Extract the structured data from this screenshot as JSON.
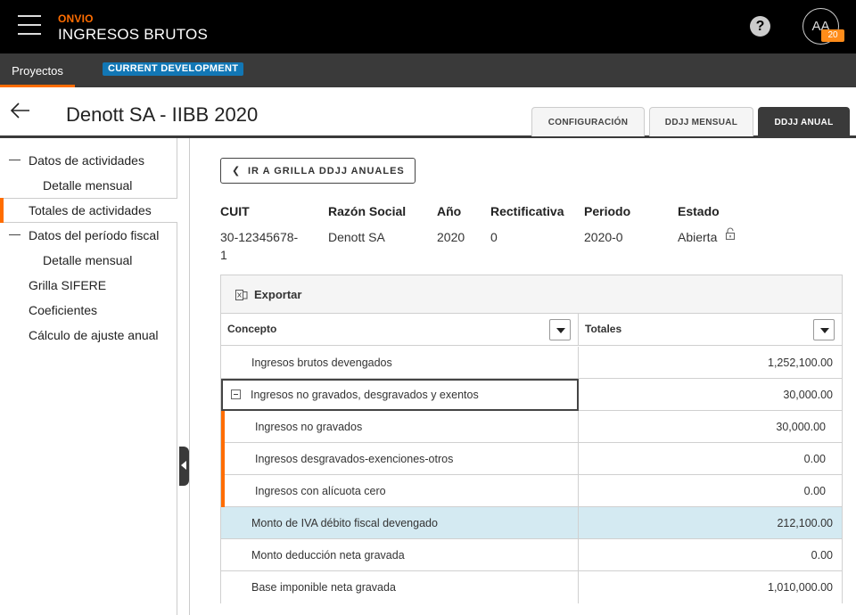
{
  "header": {
    "brand": "ONVIO",
    "product": "INGRESOS BRUTOS",
    "help_icon": "question-circle-icon",
    "avatar_initials": "AA",
    "avatar_badge": "20"
  },
  "navbar": {
    "tab": "Proyectos",
    "env_badge": "CURRENT DEVELOPMENT"
  },
  "title": "Denott SA - IIBB 2020",
  "tabs": [
    {
      "label": "CONFIGURACIÓN",
      "active": false
    },
    {
      "label": "DDJJ MENSUAL",
      "active": false
    },
    {
      "label": "DDJJ ANUAL",
      "active": true
    }
  ],
  "sidebar": {
    "items": [
      {
        "label": "Datos de actividades",
        "level": 0,
        "expanded": true
      },
      {
        "label": "Detalle mensual",
        "level": 1
      },
      {
        "label": "Totales de actividades",
        "level": 0,
        "active": true
      },
      {
        "label": "Datos del período fiscal",
        "level": 0,
        "expanded": true
      },
      {
        "label": "Detalle mensual",
        "level": 1
      },
      {
        "label": "Grilla SIFERE",
        "level": 0
      },
      {
        "label": "Coeficientes",
        "level": 0
      },
      {
        "label": "Cálculo de ajuste anual",
        "level": 0
      }
    ]
  },
  "goto_button": "IR A GRILLA DDJJ ANUALES",
  "info": {
    "labels": [
      "CUIT",
      "Razón Social",
      "Año",
      "Rectificativa",
      "Periodo",
      "Estado"
    ],
    "cuit": "30-12345678-",
    "cuit_line2": "1",
    "razon_social": "Denott SA",
    "anio": "2020",
    "rectificativa": "0",
    "periodo": "2020-0",
    "estado": "Abierta"
  },
  "grid": {
    "export_label": "Exportar",
    "columns": [
      "Concepto",
      "Totales"
    ],
    "rows": [
      {
        "concept": "Ingresos brutos devengados",
        "total": "1,252,100.00"
      },
      {
        "concept": "Ingresos no gravados, desgravados y exentos",
        "total": "30,000.00"
      },
      {
        "concept": "Ingresos no gravados",
        "total": "30,000.00"
      },
      {
        "concept": "Ingresos desgravados-exenciones-otros",
        "total": "0.00"
      },
      {
        "concept": "Ingresos con alícuota cero",
        "total": "0.00"
      },
      {
        "concept": "Monto de IVA débito fiscal devengado",
        "total": "212,100.00"
      },
      {
        "concept": "Monto deducción neta gravada",
        "total": "0.00"
      },
      {
        "concept": "Base imponible neta gravada",
        "total": "1,010,000.00"
      }
    ]
  },
  "colors": {
    "accent": "#ff6d00",
    "header_bg": "#000000",
    "navbar_bg": "#3a3a3a",
    "env_badge": "#1277b5",
    "selected_row": "#d4eaf2"
  }
}
